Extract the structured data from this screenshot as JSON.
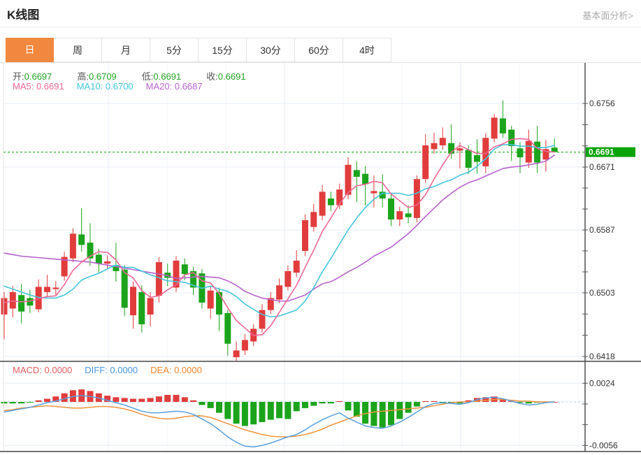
{
  "header": {
    "title": "K线图",
    "link_label": "基本面分析>"
  },
  "tabs": {
    "items": [
      "日",
      "周",
      "月",
      "5分",
      "15分",
      "30分",
      "60分",
      "4时"
    ],
    "active_index": 0,
    "active_color": "#f0883f"
  },
  "ohlc_legend": {
    "items": [
      {
        "label": "开:",
        "value": "0.6697"
      },
      {
        "label": "高:",
        "value": "0.6709"
      },
      {
        "label": "低:",
        "value": "0.6691"
      },
      {
        "label": "收:",
        "value": "0.6691"
      }
    ],
    "value_color": "#22a522"
  },
  "ma_legend": {
    "items": [
      {
        "label": "MA5:",
        "value": "0.6691",
        "color": "#ee6795"
      },
      {
        "label": "MA10:",
        "value": "0.6700",
        "color": "#45c5dc"
      },
      {
        "label": "MA20:",
        "value": "0.6687",
        "color": "#b763cf"
      }
    ]
  },
  "macd_legend": {
    "items": [
      {
        "label": "MACD:",
        "value": "0.0000",
        "color": "#e35f5f"
      },
      {
        "label": "DIFF:",
        "value": "0.0000",
        "color": "#4a97e3"
      },
      {
        "label": "DEA:",
        "value": "0.0000",
        "color": "#f0862d"
      }
    ]
  },
  "price_axis": {
    "tick_values": [
      0.6756,
      0.6671,
      0.6587,
      0.6503,
      0.6418
    ],
    "current_price": "0.6691",
    "badge_color": "#09a309"
  },
  "macd_axis": {
    "tick_values": [
      0.0024,
      -0.0056
    ]
  },
  "colors": {
    "up": "#e13c3c",
    "down": "#1ba41b",
    "ma5": "#ee6795",
    "ma10": "#45c5dc",
    "ma20": "#b763cf",
    "diff": "#58a0dd",
    "dea": "#f1933f",
    "price_dash": "#2db52d",
    "zero_dash": "#b5d9f2",
    "grid": "#e7edf4",
    "grid_minor": "#f1f4f9",
    "axis": "#444",
    "tick_text": "#333"
  },
  "chart_data": {
    "type": "candlestick_with_macd",
    "price_range": {
      "top": 0.6756,
      "bottom": 0.6418
    },
    "macd_range": {
      "top": 0.0024,
      "bottom": -0.0056
    },
    "candles": [
      {
        "o": 0.6474,
        "h": 0.6504,
        "l": 0.6441,
        "c": 0.6496
      },
      {
        "o": 0.6482,
        "h": 0.6512,
        "l": 0.647,
        "c": 0.6504
      },
      {
        "o": 0.65,
        "h": 0.6515,
        "l": 0.6462,
        "c": 0.6478
      },
      {
        "o": 0.6496,
        "h": 0.6507,
        "l": 0.6476,
        "c": 0.6486
      },
      {
        "o": 0.6481,
        "h": 0.6521,
        "l": 0.6477,
        "c": 0.6511
      },
      {
        "o": 0.6504,
        "h": 0.6527,
        "l": 0.6498,
        "c": 0.6511
      },
      {
        "o": 0.6508,
        "h": 0.6519,
        "l": 0.65,
        "c": 0.651
      },
      {
        "o": 0.6525,
        "h": 0.6558,
        "l": 0.6519,
        "c": 0.6551
      },
      {
        "o": 0.6549,
        "h": 0.6589,
        "l": 0.6544,
        "c": 0.6582
      },
      {
        "o": 0.6581,
        "h": 0.6616,
        "l": 0.6558,
        "c": 0.6567
      },
      {
        "o": 0.657,
        "h": 0.6596,
        "l": 0.6539,
        "c": 0.6549
      },
      {
        "o": 0.6554,
        "h": 0.6562,
        "l": 0.653,
        "c": 0.6542
      },
      {
        "o": 0.6542,
        "h": 0.6553,
        "l": 0.6535,
        "c": 0.6545
      },
      {
        "o": 0.654,
        "h": 0.657,
        "l": 0.6518,
        "c": 0.6532
      },
      {
        "o": 0.6534,
        "h": 0.654,
        "l": 0.6472,
        "c": 0.6483
      },
      {
        "o": 0.6473,
        "h": 0.6518,
        "l": 0.6455,
        "c": 0.6511
      },
      {
        "o": 0.6504,
        "h": 0.6513,
        "l": 0.645,
        "c": 0.6461
      },
      {
        "o": 0.6474,
        "h": 0.6504,
        "l": 0.6458,
        "c": 0.6496
      },
      {
        "o": 0.6499,
        "h": 0.6551,
        "l": 0.649,
        "c": 0.6544
      },
      {
        "o": 0.653,
        "h": 0.6542,
        "l": 0.6512,
        "c": 0.6523
      },
      {
        "o": 0.651,
        "h": 0.6552,
        "l": 0.6504,
        "c": 0.6546
      },
      {
        "o": 0.6541,
        "h": 0.6549,
        "l": 0.652,
        "c": 0.6528
      },
      {
        "o": 0.6532,
        "h": 0.6538,
        "l": 0.65,
        "c": 0.651
      },
      {
        "o": 0.6529,
        "h": 0.6535,
        "l": 0.6482,
        "c": 0.649
      },
      {
        "o": 0.6482,
        "h": 0.6512,
        "l": 0.6468,
        "c": 0.6506
      },
      {
        "o": 0.6504,
        "h": 0.651,
        "l": 0.6452,
        "c": 0.6474
      },
      {
        "o": 0.6476,
        "h": 0.648,
        "l": 0.6419,
        "c": 0.6435
      },
      {
        "o": 0.6417,
        "h": 0.6438,
        "l": 0.6412,
        "c": 0.6426
      },
      {
        "o": 0.6426,
        "h": 0.6448,
        "l": 0.642,
        "c": 0.644
      },
      {
        "o": 0.6438,
        "h": 0.6461,
        "l": 0.6432,
        "c": 0.6455
      },
      {
        "o": 0.6455,
        "h": 0.6488,
        "l": 0.645,
        "c": 0.648
      },
      {
        "o": 0.648,
        "h": 0.6504,
        "l": 0.6475,
        "c": 0.6496
      },
      {
        "o": 0.6494,
        "h": 0.6522,
        "l": 0.6489,
        "c": 0.6513
      },
      {
        "o": 0.6511,
        "h": 0.654,
        "l": 0.6506,
        "c": 0.6532
      },
      {
        "o": 0.653,
        "h": 0.656,
        "l": 0.6524,
        "c": 0.6546
      },
      {
        "o": 0.6559,
        "h": 0.6608,
        "l": 0.6552,
        "c": 0.66
      },
      {
        "o": 0.6591,
        "h": 0.6622,
        "l": 0.6585,
        "c": 0.6611
      },
      {
        "o": 0.6606,
        "h": 0.6647,
        "l": 0.66,
        "c": 0.6638
      },
      {
        "o": 0.6629,
        "h": 0.6638,
        "l": 0.6612,
        "c": 0.662
      },
      {
        "o": 0.662,
        "h": 0.6649,
        "l": 0.6615,
        "c": 0.6641
      },
      {
        "o": 0.6634,
        "h": 0.6684,
        "l": 0.6628,
        "c": 0.6674
      },
      {
        "o": 0.6667,
        "h": 0.6679,
        "l": 0.6624,
        "c": 0.6658
      },
      {
        "o": 0.6662,
        "h": 0.6672,
        "l": 0.662,
        "c": 0.6648
      },
      {
        "o": 0.6636,
        "h": 0.666,
        "l": 0.6617,
        "c": 0.6639
      },
      {
        "o": 0.6638,
        "h": 0.6661,
        "l": 0.6617,
        "c": 0.6629
      },
      {
        "o": 0.6629,
        "h": 0.6635,
        "l": 0.6592,
        "c": 0.6601
      },
      {
        "o": 0.6601,
        "h": 0.6618,
        "l": 0.6592,
        "c": 0.6612
      },
      {
        "o": 0.6609,
        "h": 0.662,
        "l": 0.6596,
        "c": 0.6604
      },
      {
        "o": 0.6603,
        "h": 0.666,
        "l": 0.6597,
        "c": 0.6655
      },
      {
        "o": 0.6655,
        "h": 0.6715,
        "l": 0.665,
        "c": 0.67
      },
      {
        "o": 0.6695,
        "h": 0.6717,
        "l": 0.6689,
        "c": 0.6703
      },
      {
        "o": 0.67,
        "h": 0.6724,
        "l": 0.6694,
        "c": 0.671
      },
      {
        "o": 0.6703,
        "h": 0.6728,
        "l": 0.6682,
        "c": 0.6689
      },
      {
        "o": 0.6693,
        "h": 0.6704,
        "l": 0.6669,
        "c": 0.6696
      },
      {
        "o": 0.6694,
        "h": 0.67,
        "l": 0.6662,
        "c": 0.667
      },
      {
        "o": 0.6687,
        "h": 0.6708,
        "l": 0.6662,
        "c": 0.6678
      },
      {
        "o": 0.6672,
        "h": 0.6716,
        "l": 0.6663,
        "c": 0.671
      },
      {
        "o": 0.6709,
        "h": 0.6742,
        "l": 0.6704,
        "c": 0.6737
      },
      {
        "o": 0.6736,
        "h": 0.676,
        "l": 0.671,
        "c": 0.6716
      },
      {
        "o": 0.6721,
        "h": 0.6726,
        "l": 0.6679,
        "c": 0.6699
      },
      {
        "o": 0.6696,
        "h": 0.6704,
        "l": 0.6663,
        "c": 0.6684
      },
      {
        "o": 0.6677,
        "h": 0.6721,
        "l": 0.667,
        "c": 0.6706
      },
      {
        "o": 0.6705,
        "h": 0.6726,
        "l": 0.6663,
        "c": 0.6677
      },
      {
        "o": 0.6681,
        "h": 0.6707,
        "l": 0.6665,
        "c": 0.6695
      },
      {
        "o": 0.6697,
        "h": 0.6709,
        "l": 0.6691,
        "c": 0.6691
      }
    ],
    "ma5": [
      0.649,
      0.6492,
      0.6491,
      0.6492,
      0.6495,
      0.6498,
      0.6499,
      0.6514,
      0.6533,
      0.6544,
      0.6552,
      0.6558,
      0.6557,
      0.6547,
      0.653,
      0.6523,
      0.6506,
      0.6497,
      0.6499,
      0.6507,
      0.6514,
      0.6527,
      0.653,
      0.6519,
      0.6516,
      0.6502,
      0.6483,
      0.6466,
      0.6456,
      0.6446,
      0.6447,
      0.6459,
      0.6477,
      0.6495,
      0.6513,
      0.6537,
      0.656,
      0.6585,
      0.6603,
      0.6622,
      0.6637,
      0.6646,
      0.6648,
      0.6652,
      0.665,
      0.6635,
      0.6626,
      0.6617,
      0.662,
      0.6634,
      0.6655,
      0.6674,
      0.6691,
      0.67,
      0.6694,
      0.6689,
      0.6689,
      0.6698,
      0.6702,
      0.6708,
      0.6709,
      0.6708,
      0.6696,
      0.6692,
      0.6691
    ],
    "ma10": [
      0.6512,
      0.6508,
      0.6504,
      0.65,
      0.6497,
      0.6496,
      0.6496,
      0.65,
      0.6508,
      0.652,
      0.6525,
      0.6529,
      0.6535,
      0.654,
      0.6537,
      0.6537,
      0.6532,
      0.6527,
      0.6523,
      0.6519,
      0.6518,
      0.6517,
      0.6513,
      0.6509,
      0.6512,
      0.6508,
      0.6505,
      0.6498,
      0.6488,
      0.6481,
      0.6474,
      0.6471,
      0.6472,
      0.6476,
      0.648,
      0.6492,
      0.651,
      0.6531,
      0.6549,
      0.6568,
      0.6587,
      0.6603,
      0.6617,
      0.6628,
      0.6636,
      0.6636,
      0.6636,
      0.6633,
      0.6636,
      0.6642,
      0.6645,
      0.665,
      0.6654,
      0.666,
      0.6664,
      0.6672,
      0.6682,
      0.6695,
      0.6701,
      0.6701,
      0.6699,
      0.6699,
      0.6697,
      0.6697,
      0.67
    ],
    "ma20": [
      0.6556,
      0.6554,
      0.6552,
      0.6551,
      0.655,
      0.6549,
      0.6548,
      0.6547,
      0.6546,
      0.6545,
      0.6544,
      0.6542,
      0.654,
      0.6538,
      0.6536,
      0.6534,
      0.6532,
      0.653,
      0.6528,
      0.6526,
      0.6522,
      0.6523,
      0.6524,
      0.6525,
      0.6524,
      0.6523,
      0.6519,
      0.6513,
      0.6505,
      0.65,
      0.6496,
      0.6494,
      0.6492,
      0.6492,
      0.6496,
      0.65,
      0.6508,
      0.6515,
      0.6518,
      0.6524,
      0.6531,
      0.6537,
      0.6544,
      0.6552,
      0.6558,
      0.6564,
      0.6573,
      0.6582,
      0.6593,
      0.6605,
      0.6616,
      0.6627,
      0.6636,
      0.6644,
      0.665,
      0.6654,
      0.6659,
      0.6664,
      0.6669,
      0.6671,
      0.6672,
      0.6674,
      0.6676,
      0.6679,
      0.6687
    ],
    "macd_hist": [
      -0.0002,
      -0.0002,
      -0.0002,
      -0.0001,
      0.0002,
      0.0004,
      0.0007,
      0.0011,
      0.0015,
      0.0016,
      0.0014,
      0.0011,
      0.0008,
      0.0006,
      0.0005,
      0.0004,
      0.0004,
      0.0005,
      0.0007,
      0.0009,
      0.0009,
      0.0006,
      0.0002,
      -0.0004,
      -0.0008,
      -0.0014,
      -0.0022,
      -0.0028,
      -0.0031,
      -0.0029,
      -0.0026,
      -0.0023,
      -0.0021,
      -0.0022,
      -0.0012,
      -0.0008,
      -0.0005,
      -0.0002,
      -0.0002,
      0.0001,
      -0.0011,
      -0.0019,
      -0.0028,
      -0.0031,
      -0.0033,
      -0.003,
      -0.0022,
      -0.0014,
      -0.0006,
      0.0001,
      0.0001,
      -0.0002,
      -0.0002,
      -0.0002,
      0.0002,
      0.0005,
      0.0006,
      0.0007,
      0.0004,
      0.0001,
      -0.0001,
      -0.0002,
      -0.0001,
      -0.0001,
      0.0
    ],
    "diff": [
      -0.0013,
      -0.0011,
      -0.0009,
      -0.0007,
      -0.0004,
      -0.0001,
      0.0001,
      0.0004,
      0.0007,
      0.0008,
      0.0007,
      0.0005,
      0.0002,
      -0.0001,
      -0.0004,
      -0.0008,
      -0.0012,
      -0.0014,
      -0.0014,
      -0.0013,
      -0.0012,
      -0.0013,
      -0.0016,
      -0.0022,
      -0.0028,
      -0.0036,
      -0.0045,
      -0.0052,
      -0.0057,
      -0.0058,
      -0.0056,
      -0.0053,
      -0.0049,
      -0.0045,
      -0.0042,
      -0.0036,
      -0.0029,
      -0.0023,
      -0.0018,
      -0.0014,
      -0.0021,
      -0.0026,
      -0.0031,
      -0.0033,
      -0.0034,
      -0.0031,
      -0.0026,
      -0.002,
      -0.0013,
      -0.0006,
      -0.0002,
      -0.0001,
      -0.0002,
      -0.0003,
      -0.0001,
      0.0003,
      0.0005,
      0.0006,
      0.0004,
      0.0001,
      -0.0002,
      -0.0004,
      -0.0003,
      -0.0001,
      0.0
    ],
    "dea": [
      -0.0011,
      -0.001,
      -0.0008,
      -0.0007,
      -0.0006,
      -0.0005,
      -0.0006,
      -0.0007,
      -0.0008,
      -0.0008,
      -0.0007,
      -0.0006,
      -0.0006,
      -0.0007,
      -0.0009,
      -0.0012,
      -0.0016,
      -0.0019,
      -0.0021,
      -0.0022,
      -0.0021,
      -0.0019,
      -0.0018,
      -0.0018,
      -0.002,
      -0.0024,
      -0.0028,
      -0.0032,
      -0.0036,
      -0.0039,
      -0.0042,
      -0.0044,
      -0.0045,
      -0.0045,
      -0.0044,
      -0.0042,
      -0.0039,
      -0.0035,
      -0.003,
      -0.0026,
      -0.0022,
      -0.0018,
      -0.0015,
      -0.0013,
      -0.0012,
      -0.0011,
      -0.001,
      -0.0009,
      -0.0008,
      -0.0007,
      -0.0005,
      -0.0003,
      -0.0001,
      0.0,
      0.0,
      0.0001,
      0.0002,
      0.0003,
      0.0003,
      0.0002,
      0.0001,
      0.0001,
      0.0,
      0.0,
      0.0
    ]
  }
}
